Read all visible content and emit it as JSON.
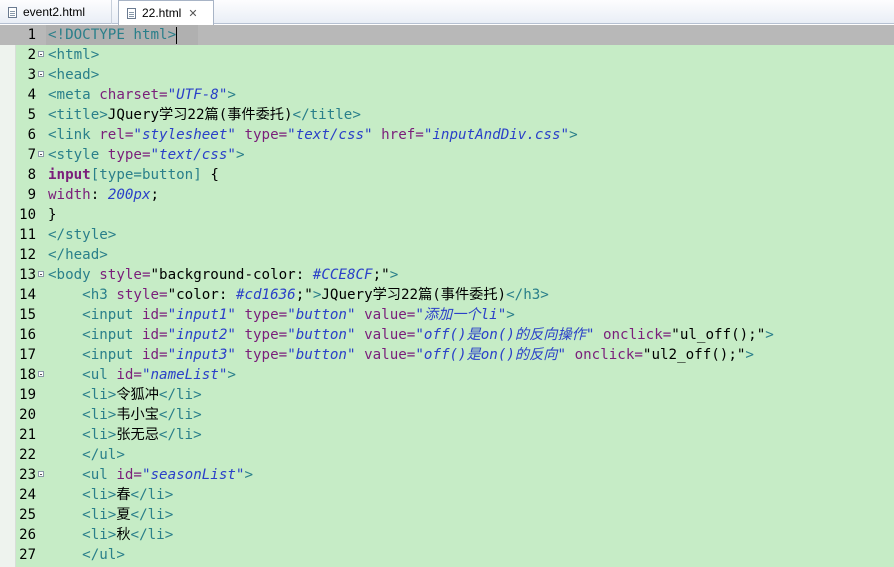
{
  "tabs": [
    {
      "label": "event2.html",
      "active": false
    },
    {
      "label": "22.html",
      "active": true
    }
  ],
  "lines": [
    {
      "n": "1",
      "fold": false,
      "segs": [
        [
          "tag",
          "<!DOCTYPE html>"
        ]
      ]
    },
    {
      "n": "2",
      "fold": true,
      "segs": [
        [
          "tag",
          "<html>"
        ]
      ]
    },
    {
      "n": "3",
      "fold": true,
      "segs": [
        [
          "tag",
          "<head>"
        ]
      ]
    },
    {
      "n": "4",
      "fold": false,
      "segs": [
        [
          "tag",
          "<meta "
        ],
        [
          "attr",
          "charset="
        ],
        [
          "val",
          "\"UTF-8\""
        ],
        [
          "tag",
          ">"
        ]
      ]
    },
    {
      "n": "5",
      "fold": false,
      "segs": [
        [
          "tag",
          "<title>"
        ],
        [
          "txt",
          "JQuery学习22篇(事件委托)"
        ],
        [
          "tag",
          "</title>"
        ]
      ]
    },
    {
      "n": "6",
      "fold": false,
      "segs": [
        [
          "tag",
          "<link "
        ],
        [
          "attr",
          "rel="
        ],
        [
          "val",
          "\"stylesheet\""
        ],
        [
          "attr",
          " type="
        ],
        [
          "val",
          "\"text/css\""
        ],
        [
          "attr",
          " href="
        ],
        [
          "val",
          "\"inputAndDiv.css\""
        ],
        [
          "tag",
          ">"
        ]
      ]
    },
    {
      "n": "7",
      "fold": true,
      "segs": [
        [
          "tag",
          "<style "
        ],
        [
          "attr",
          "type="
        ],
        [
          "val",
          "\"text/css\""
        ],
        [
          "tag",
          ">"
        ]
      ]
    },
    {
      "n": "8",
      "fold": false,
      "segs": [
        [
          "kw",
          "input"
        ],
        [
          "tag",
          "[type=button] "
        ],
        [
          "txt",
          "{"
        ]
      ]
    },
    {
      "n": "9",
      "fold": false,
      "segs": [
        [
          "attr",
          "width"
        ],
        [
          "txt",
          ": "
        ],
        [
          "val",
          "200px"
        ],
        [
          "txt",
          ";"
        ]
      ]
    },
    {
      "n": "10",
      "fold": false,
      "segs": [
        [
          "txt",
          "}"
        ]
      ]
    },
    {
      "n": "11",
      "fold": false,
      "segs": [
        [
          "tag",
          "</style>"
        ]
      ]
    },
    {
      "n": "12",
      "fold": false,
      "segs": [
        [
          "tag",
          "</head>"
        ]
      ]
    },
    {
      "n": "13",
      "fold": true,
      "segs": [
        [
          "tag",
          "<body "
        ],
        [
          "attr",
          "style="
        ],
        [
          "txt",
          "\"background-color: "
        ],
        [
          "val",
          "#CCE8CF"
        ],
        [
          "txt",
          ";\""
        ],
        [
          "tag",
          ">"
        ]
      ]
    },
    {
      "n": "14",
      "fold": false,
      "segs": [
        [
          "tag",
          "    <h3 "
        ],
        [
          "attr",
          "style="
        ],
        [
          "txt",
          "\"color: "
        ],
        [
          "val",
          "#cd1636"
        ],
        [
          "txt",
          ";\""
        ],
        [
          "tag",
          ">"
        ],
        [
          "txt",
          "JQuery学习22篇(事件委托)"
        ],
        [
          "tag",
          "</h3>"
        ]
      ]
    },
    {
      "n": "15",
      "fold": false,
      "segs": [
        [
          "tag",
          "    <input "
        ],
        [
          "attr",
          "id="
        ],
        [
          "val",
          "\"input1\""
        ],
        [
          "attr",
          " type="
        ],
        [
          "val",
          "\"button\""
        ],
        [
          "attr",
          " value="
        ],
        [
          "val",
          "\"添加一个li\""
        ],
        [
          "tag",
          ">"
        ]
      ]
    },
    {
      "n": "16",
      "fold": false,
      "segs": [
        [
          "tag",
          "    <input "
        ],
        [
          "attr",
          "id="
        ],
        [
          "val",
          "\"input2\""
        ],
        [
          "attr",
          " type="
        ],
        [
          "val",
          "\"button\""
        ],
        [
          "attr",
          " value="
        ],
        [
          "val",
          "\"off()是on()的反向操作\""
        ],
        [
          "attr",
          " onclick="
        ],
        [
          "txt",
          "\"ul_off();\""
        ],
        [
          "tag",
          ">"
        ]
      ]
    },
    {
      "n": "17",
      "fold": false,
      "segs": [
        [
          "tag",
          "    <input "
        ],
        [
          "attr",
          "id="
        ],
        [
          "val",
          "\"input3\""
        ],
        [
          "attr",
          " type="
        ],
        [
          "val",
          "\"button\""
        ],
        [
          "attr",
          " value="
        ],
        [
          "val",
          "\"off()是on()的反向\""
        ],
        [
          "attr",
          " onclick="
        ],
        [
          "txt",
          "\"ul2_off();\""
        ],
        [
          "tag",
          ">"
        ]
      ]
    },
    {
      "n": "18",
      "fold": true,
      "segs": [
        [
          "tag",
          "    <ul "
        ],
        [
          "attr",
          "id="
        ],
        [
          "val",
          "\"nameList\""
        ],
        [
          "tag",
          ">"
        ]
      ]
    },
    {
      "n": "19",
      "fold": false,
      "segs": [
        [
          "tag",
          "    <li>"
        ],
        [
          "txt",
          "令狐冲"
        ],
        [
          "tag",
          "</li>"
        ]
      ]
    },
    {
      "n": "20",
      "fold": false,
      "segs": [
        [
          "tag",
          "    <li>"
        ],
        [
          "txt",
          "韦小宝"
        ],
        [
          "tag",
          "</li>"
        ]
      ]
    },
    {
      "n": "21",
      "fold": false,
      "segs": [
        [
          "tag",
          "    <li>"
        ],
        [
          "txt",
          "张无忌"
        ],
        [
          "tag",
          "</li>"
        ]
      ]
    },
    {
      "n": "22",
      "fold": false,
      "segs": [
        [
          "tag",
          "    </ul>"
        ]
      ]
    },
    {
      "n": "23",
      "fold": true,
      "segs": [
        [
          "tag",
          "    <ul "
        ],
        [
          "attr",
          "id="
        ],
        [
          "val",
          "\"seasonList\""
        ],
        [
          "tag",
          ">"
        ]
      ]
    },
    {
      "n": "24",
      "fold": false,
      "segs": [
        [
          "tag",
          "    <li>"
        ],
        [
          "txt",
          "春"
        ],
        [
          "tag",
          "</li>"
        ]
      ]
    },
    {
      "n": "25",
      "fold": false,
      "segs": [
        [
          "tag",
          "    <li>"
        ],
        [
          "txt",
          "夏"
        ],
        [
          "tag",
          "</li>"
        ]
      ]
    },
    {
      "n": "26",
      "fold": false,
      "segs": [
        [
          "tag",
          "    <li>"
        ],
        [
          "txt",
          "秋"
        ],
        [
          "tag",
          "</li>"
        ]
      ]
    },
    {
      "n": "27",
      "fold": false,
      "segs": [
        [
          "tag",
          "    </ul>"
        ]
      ]
    }
  ],
  "colors": {
    "editor_bg": "#c6ecc6",
    "tag": "#2a7f8a",
    "attribute": "#7a1e7a",
    "value": "#2a40c8"
  },
  "icons": {
    "tab_file": "html-file-icon",
    "tab_close": "close-icon",
    "fold": "fold-toggle-icon"
  }
}
